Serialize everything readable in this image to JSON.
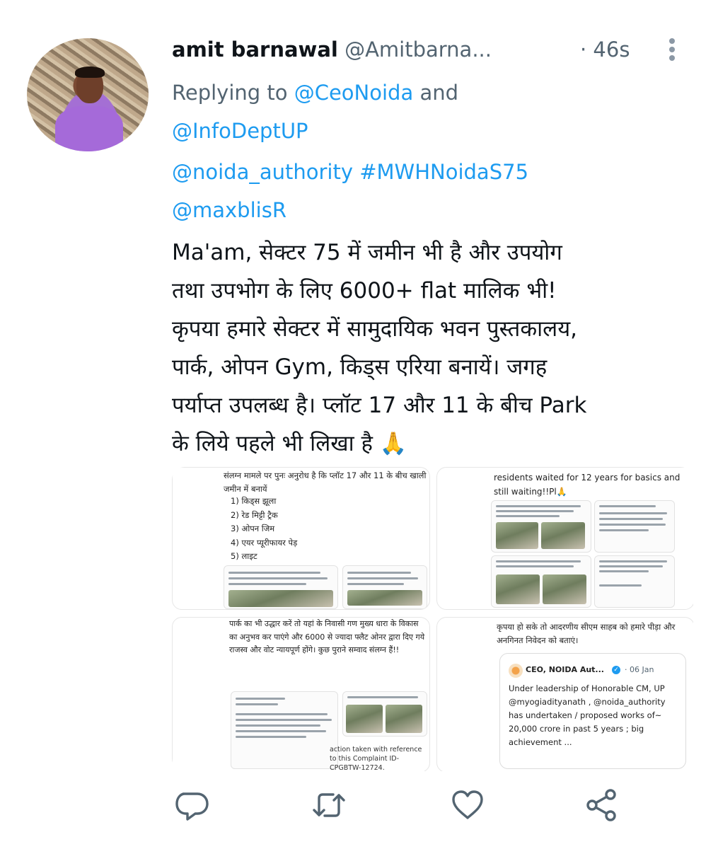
{
  "tweet": {
    "author_name": "amit barnawal",
    "author_handle": "@Amitbarna...",
    "time": "· 46s",
    "reply_prefix": "Replying to ",
    "reply_to_1": "@CeoNoida",
    "reply_and": " and",
    "reply_to_2": "@InfoDeptUP",
    "mention_1": "@noida_authority",
    "hashtag": "#MWHNoidaS75",
    "mention_2": "@maxblisR",
    "text": "Ma'am, सेक्टर 75 में जमीन भी है और उपयोग\nतथा उपभोग के लिए 6000+ flat मालिक भी!\nकृपया हमारे सेक्टर में सामुदायिक भवन पुस्तकालय,\nपार्क, ओपन Gym, किड्स एरिया बनायें। जगह\nपर्याप्त उपलब्ध है। प्लॉट 17 और 11 के बीच Park\nके लिये पहले भी लिखा है 🙏"
  },
  "media": {
    "tile1": {
      "text": "संलग्न मामले पर पुनः अनुरोध है कि प्लॉट 17 और 11 के बीच खाली जमीन में बनायें",
      "items": [
        "1) किड्स झूला",
        "2) रेड मिट्टी ट्रैक",
        "3) ओपन जिम",
        "4) एयर प्यूरीफायर पेड़",
        "5) लाइट"
      ]
    },
    "tile2": {
      "text": "residents waited for 12 years for basics and still waiting!!Pl🙏"
    },
    "tile3": {
      "text": "पार्क का भी उद्धार करें तो यहां के निवासी गण मुख्य धारा के विकास का अनुभव कर पाएंगे और 6000 से ज्यादा फ्लैट ओनर द्वारा दिए गये राजस्व और वोट न्यायपूर्ण होंगे। कुछ पुराने सम्वाद संलग्न हैं!!",
      "bottom": "action taken with reference to this Complaint ID-CPGBTW-12724."
    },
    "tile4": {
      "text": "कृपया हो सके तो आदरणीय सीएम साहब को हमारे पीड़ा और अनगिनत निवेदन को बताएं।",
      "quote_name": "CEO, NOIDA Aut...",
      "quote_date": "· 06 Jan",
      "quote_text": "Under leadership of Honorable CM, UP @myogiadityanath , @noida_authority has undertaken / proposed works of~ 20,000 crore in past 5 years ; big achievement ..."
    }
  },
  "actions": {
    "reply_icon": "reply-icon",
    "retweet_icon": "retweet-icon",
    "like_icon": "like-icon",
    "share_icon": "share-icon"
  },
  "colors": {
    "link": "#1d9bf0",
    "secondary": "#536471",
    "text": "#0f1419",
    "action_icon": "#536471"
  }
}
